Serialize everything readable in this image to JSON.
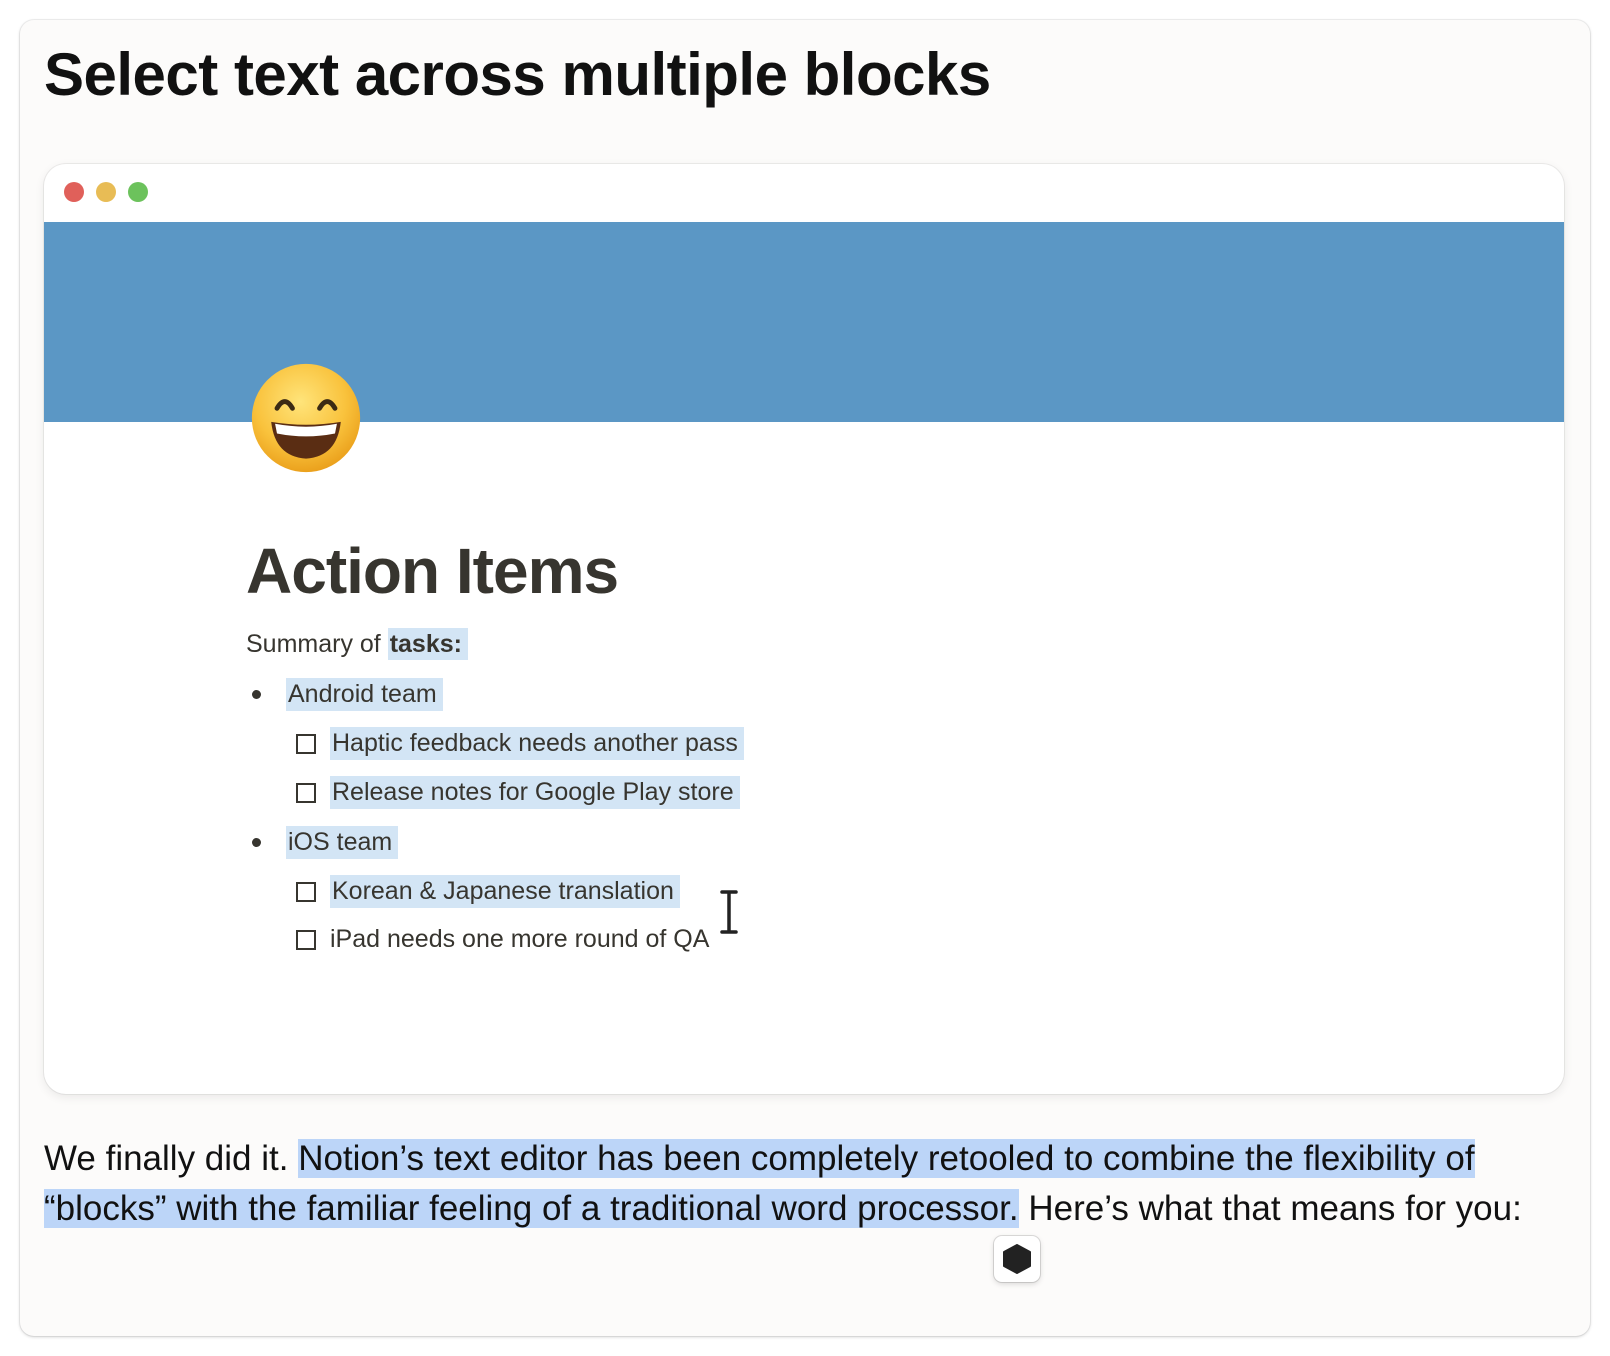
{
  "page": {
    "heading": "Select text across multiple blocks"
  },
  "window": {
    "traffic_lights": {
      "red": "#e0605a",
      "yellow": "#e8bc55",
      "green": "#6cc25c"
    },
    "cover_color": "#5b97c5",
    "page_icon": "grinning-face-with-smiling-eyes-emoji",
    "page_title": "Action Items",
    "summary": {
      "prefix": "Summary of ",
      "bold": "tasks:"
    },
    "groups": [
      {
        "label": "Android team",
        "todos": [
          "Haptic feedback needs another pass",
          "Release notes for Google Play store"
        ]
      },
      {
        "label": "iOS team",
        "todos": [
          "Korean & Japanese translation",
          "iPad needs one more round of QA"
        ]
      }
    ],
    "selection_color": "#d3e5f5"
  },
  "body": {
    "text_before": "We finally did it. ",
    "text_selected": "Notion’s text editor has been completely retooled to combine the flexibility of “blocks” with the familiar feeling of a traditional word processor.",
    "text_after": " Here’s what that means for you:",
    "selection_color": "#bcd5f8"
  },
  "floating_button_icon": "hexagon-icon"
}
